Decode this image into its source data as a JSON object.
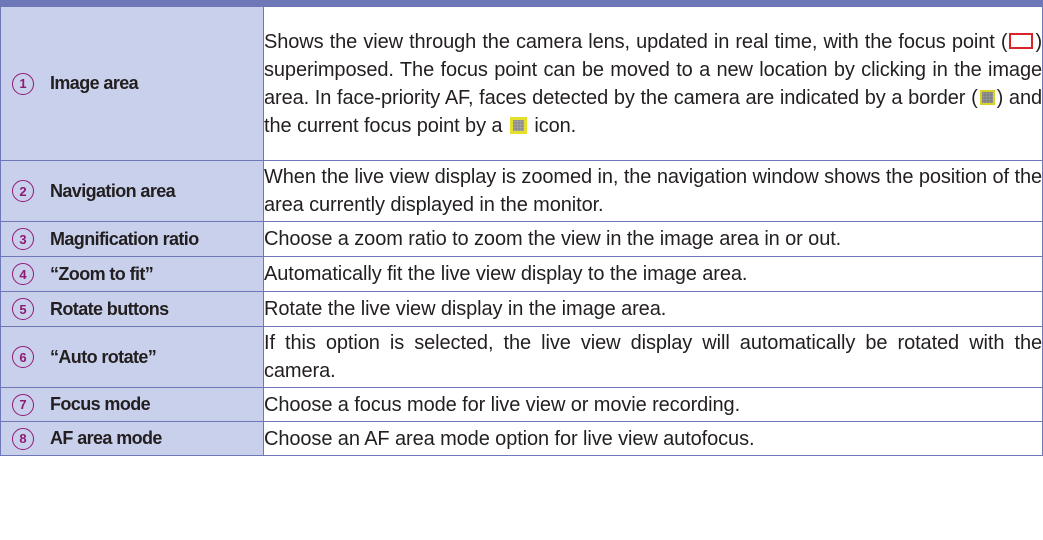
{
  "rows": [
    {
      "num": "1",
      "term": "Image area",
      "parts": [
        "Shows the view through the camera lens, updated in real time, with the focus point (",
        ") superimposed. The focus point can be moved to a new location by clicking in the image area. In face-priority AF, faces detected by the camera are indicated by a border (",
        ") and the current focus point by a ",
        " icon."
      ],
      "icons": [
        "red-focus-frame-icon",
        "face-border-icon",
        "current-focus-point-icon"
      ]
    },
    {
      "num": "2",
      "term": "Navigation area",
      "desc": "When the live view display is zoomed in, the navigation window shows the position of the area currently displayed in the monitor."
    },
    {
      "num": "3",
      "term": "Magnification ratio",
      "desc": "Choose a zoom ratio to zoom the view in the image area in or out."
    },
    {
      "num": "4",
      "term": "“Zoom to fit”",
      "desc": "Automatically fit the live view display to the image area."
    },
    {
      "num": "5",
      "term": "Rotate buttons",
      "desc": "Rotate the live view display in the image area."
    },
    {
      "num": "6",
      "term": "“Auto rotate”",
      "desc": "If this option is selected, the live view display will automatically be rotated with the camera."
    },
    {
      "num": "7",
      "term": "Focus mode",
      "desc": "Choose a focus mode for live view or movie recording."
    },
    {
      "num": "8",
      "term": "AF area mode",
      "desc": "Choose an AF area mode option for live view autofocus."
    }
  ],
  "colors": {
    "header_bg": "#c9d0ec",
    "border": "#6e78b8",
    "number": "#8f1a75",
    "focus_frame": "#d8232a",
    "face_border": "#d6d223"
  }
}
